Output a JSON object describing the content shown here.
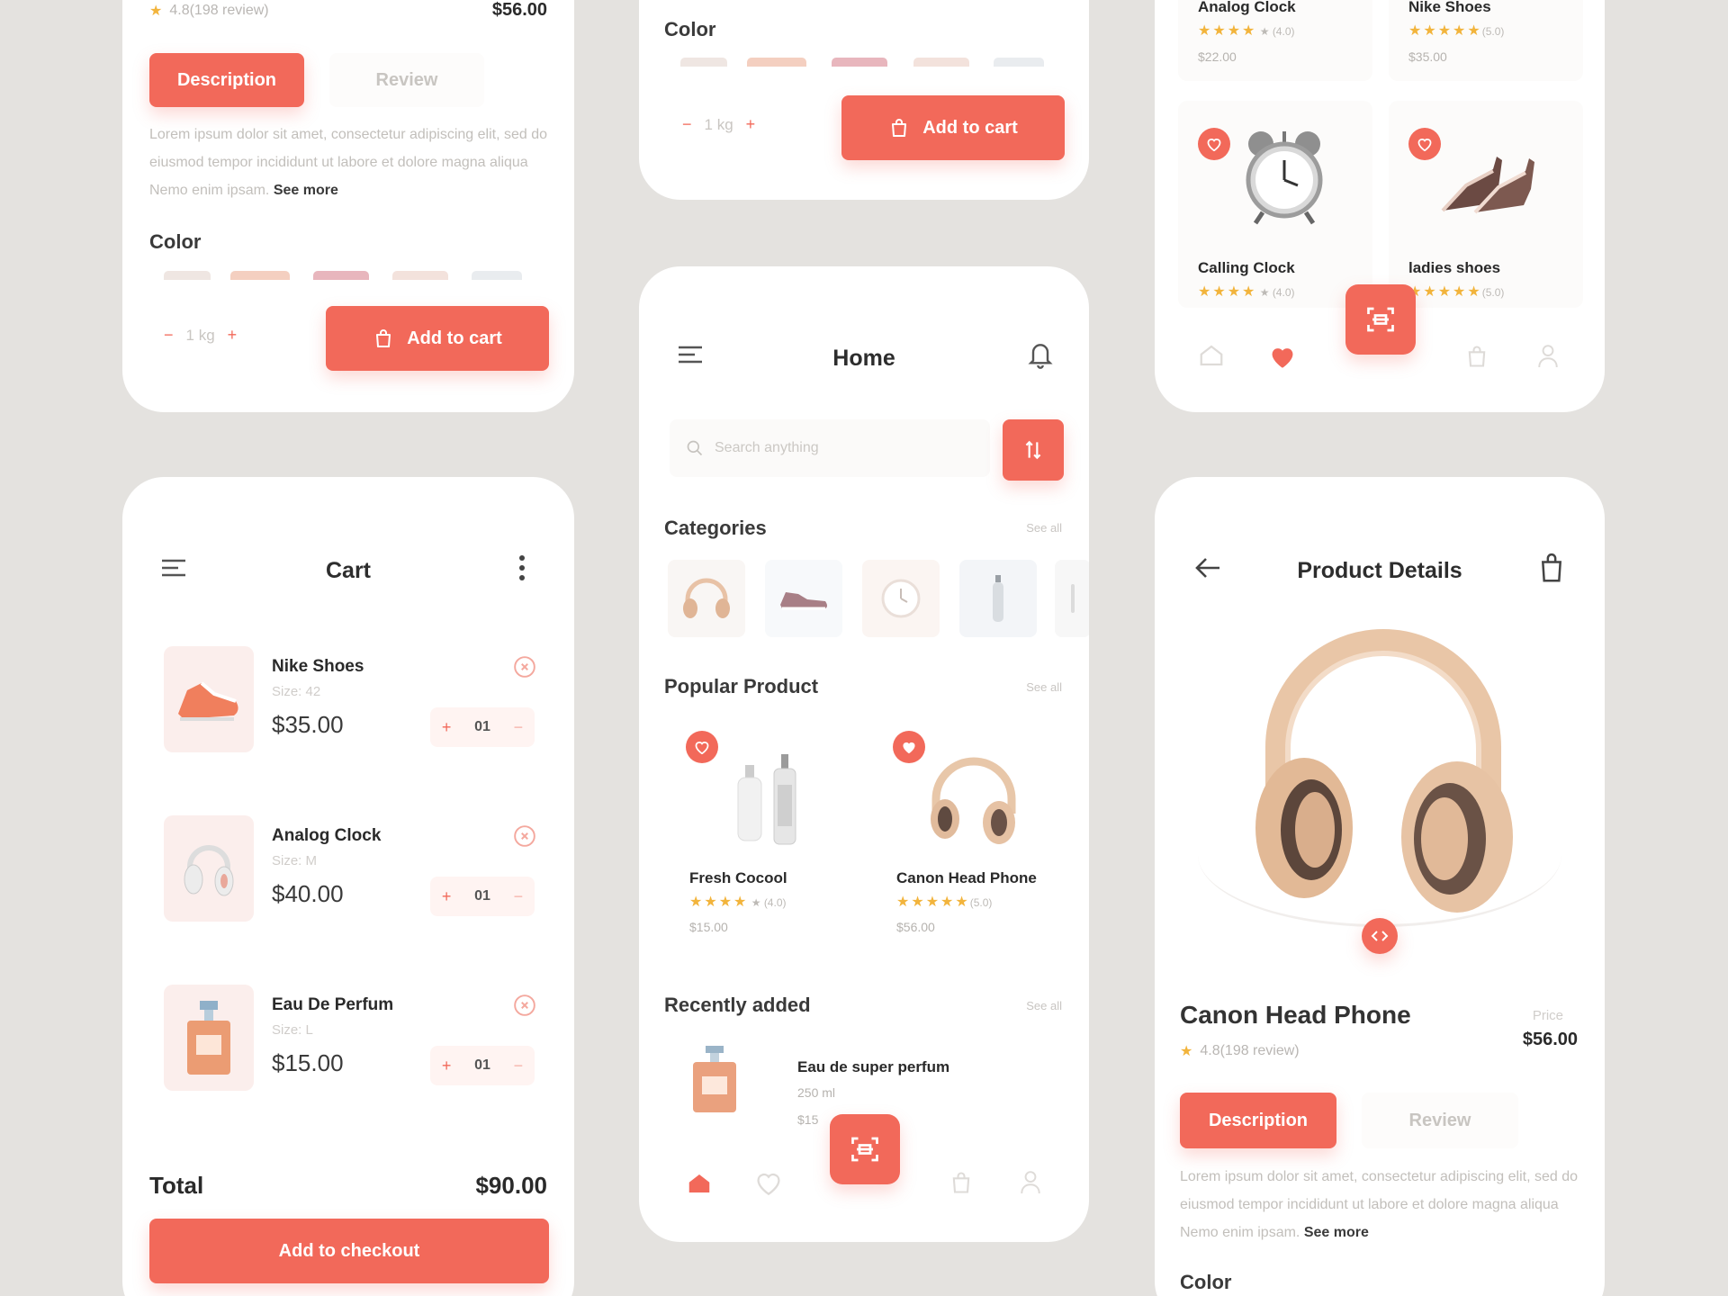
{
  "colors": {
    "accent": "#f2695a",
    "background": "#e4e2df",
    "card": "#ffffff",
    "star": "#f2b43c"
  },
  "card_desc_top": {
    "rating_text": "4.8(198 review)",
    "price": "$56.00",
    "tab_description": "Description",
    "tab_review": "Review",
    "lorem": "Lorem ipsum dolor sit amet, consectetur adipiscing elit, sed do eiusmod tempor incididunt ut labore et dolore magna aliqua Nemo enim ipsam.",
    "see_more": "See more",
    "color_label": "Color",
    "qty_minus": "−",
    "qty_value": "1 kg",
    "qty_plus": "+",
    "add_to_cart": "Add to cart"
  },
  "card_cart_top": {
    "color_label": "Color",
    "qty_minus": "−",
    "qty_value": "1 kg",
    "qty_plus": "+",
    "add_to_cart": "Add to cart"
  },
  "card_favs": {
    "products_top": [
      {
        "name": "Analog Clock",
        "rating": "(4.0)",
        "price": "$22.00"
      },
      {
        "name": "Nike Shoes",
        "rating": "(5.0)",
        "price": "$35.00"
      }
    ],
    "products_bottom": [
      {
        "name": "Calling Clock",
        "rating": "(4.0)"
      },
      {
        "name": "ladies shoes",
        "rating": "(5.0)"
      }
    ]
  },
  "home": {
    "title": "Home",
    "search_placeholder": "Search anything",
    "categories_label": "Categories",
    "see_all": "See all",
    "popular_label": "Popular Product",
    "popular": [
      {
        "name": "Fresh Cocool",
        "rating": "(4.0)",
        "price": "$15.00"
      },
      {
        "name": "Canon Head Phone",
        "rating": "(5.0)",
        "price": "$56.00"
      }
    ],
    "recent_label": "Recently added",
    "recent": {
      "name": "Eau de super perfum",
      "size": "250 ml",
      "price": "$15"
    }
  },
  "cart": {
    "title": "Cart",
    "items": [
      {
        "name": "Nike Shoes",
        "size": "Size: 42",
        "price": "$35.00",
        "qty": "01"
      },
      {
        "name": "Analog Clock",
        "size": "Size: M",
        "price": "$40.00",
        "qty": "01"
      },
      {
        "name": "Eau De Perfum",
        "size": "Size: L",
        "price": "$15.00",
        "qty": "01"
      }
    ],
    "total_label": "Total",
    "total_value": "$90.00",
    "checkout": "Add to checkout",
    "plus": "+",
    "minus": "−"
  },
  "details": {
    "title": "Product Details",
    "product_name": "Canon Head Phone",
    "price_label": "Price",
    "price": "$56.00",
    "rating_text": "4.8(198 review)",
    "tab_description": "Description",
    "tab_review": "Review",
    "lorem": "Lorem ipsum dolor sit amet, consectetur adipiscing elit, sed do eiusmod tempor incididunt ut labore et dolore magna aliqua Nemo enim ipsam.",
    "see_more": "See more",
    "color_label": "Color"
  }
}
